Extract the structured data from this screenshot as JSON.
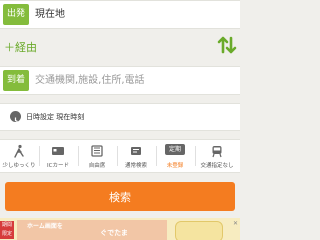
{
  "departure": {
    "tag": "出発",
    "value": "現在地"
  },
  "via": {
    "label": "＋経由"
  },
  "arrival": {
    "tag": "到着",
    "placeholder": "交通機関,施設,住所,電話"
  },
  "time_setting": {
    "label": "日時設定 現在時刻"
  },
  "options": [
    {
      "label": "少しゆっくり",
      "icon": "walking-icon"
    },
    {
      "label": "ICカード",
      "icon": "ic-card-icon"
    },
    {
      "label": "自由席",
      "icon": "seat-icon"
    },
    {
      "label": "通常検索",
      "icon": "search-mode-icon"
    },
    {
      "label": "未登録",
      "icon": "commuter-pass-icon",
      "badge": "定期"
    },
    {
      "label": "交通指定なし",
      "icon": "transport-icon"
    }
  ],
  "search_button": {
    "label": "検索"
  },
  "ad": {
    "badge": "期間限定",
    "text": "ホーム画面を",
    "brand": "ぐでたま"
  },
  "colors": {
    "accent_green": "#84bc3c",
    "search_orange": "#f47c20",
    "background": "#f0efeb"
  }
}
